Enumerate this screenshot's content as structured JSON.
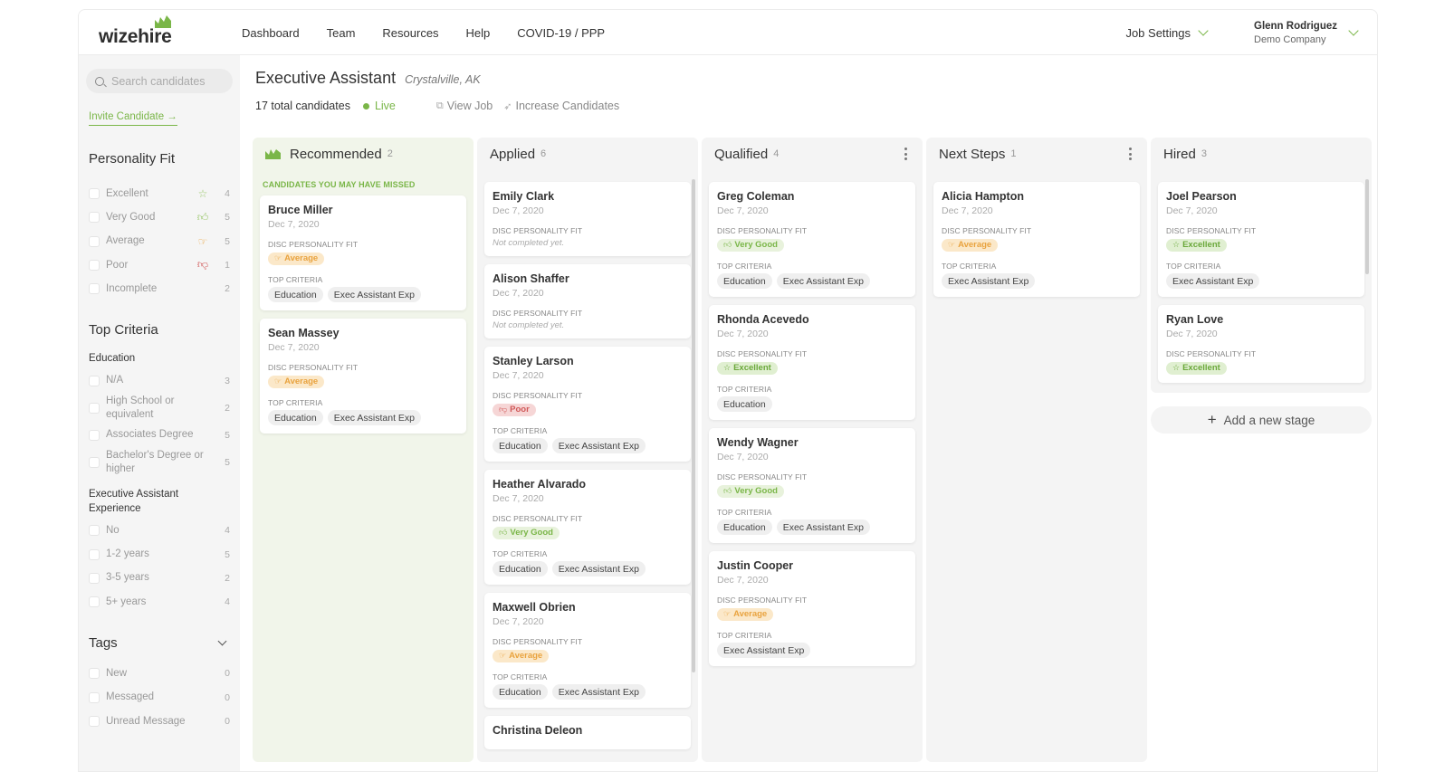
{
  "nav": {
    "logo": "wizehire",
    "links": [
      "Dashboard",
      "Team",
      "Resources",
      "Help",
      "COVID-19 / PPP"
    ],
    "job_settings": "Job Settings",
    "user_name": "Glenn Rodriguez",
    "user_company": "Demo Company"
  },
  "sidebar": {
    "search_placeholder": "Search candidates",
    "invite": "Invite Candidate →",
    "personality_fit": {
      "title": "Personality Fit",
      "items": [
        {
          "label": "Excellent",
          "icon": "star-icon",
          "count": "4"
        },
        {
          "label": "Very Good",
          "icon": "thumbs-up-icon",
          "count": "5"
        },
        {
          "label": "Average",
          "icon": "thumb-sideways-icon",
          "count": "5"
        },
        {
          "label": "Poor",
          "icon": "thumbs-down-icon",
          "count": "1"
        },
        {
          "label": "Incomplete",
          "icon": "",
          "count": "2"
        }
      ]
    },
    "top_criteria": {
      "title": "Top Criteria",
      "education": {
        "title": "Education",
        "items": [
          {
            "label": "N/A",
            "count": "3"
          },
          {
            "label": "High School or equivalent",
            "count": "2"
          },
          {
            "label": "Associates Degree",
            "count": "5"
          },
          {
            "label": "Bachelor's Degree or higher",
            "count": "5"
          }
        ]
      },
      "experience": {
        "title": "Executive Assistant Experience",
        "items": [
          {
            "label": "No",
            "count": "4"
          },
          {
            "label": "1-2 years",
            "count": "5"
          },
          {
            "label": "3-5 years",
            "count": "2"
          },
          {
            "label": "5+ years",
            "count": "4"
          }
        ]
      }
    },
    "tags": {
      "title": "Tags",
      "items": [
        {
          "label": "New",
          "count": "0"
        },
        {
          "label": "Messaged",
          "count": "0"
        },
        {
          "label": "Unread Message",
          "count": "0"
        }
      ]
    }
  },
  "job": {
    "title": "Executive Assistant",
    "location": "Crystalville, AK",
    "total": "17 total candidates",
    "status": "Live",
    "view_job": "View Job",
    "increase": "Increase Candidates"
  },
  "labels": {
    "disc": "DISC PERSONALITY FIT",
    "top_criteria": "TOP CRITERIA",
    "not_completed": "Not completed yet.",
    "missed": "CANDIDATES YOU MAY HAVE MISSED",
    "add_stage": "Add a new stage"
  },
  "colors": {
    "brand_green": "#7ab648",
    "average": "#e9a33f",
    "poor": "#d05858"
  },
  "columns": [
    {
      "name": "Recommended",
      "count": "2",
      "cards": [
        {
          "name": "Bruce Miller",
          "date": "Dec 7, 2020",
          "fit": "Average",
          "criteria": [
            "Education",
            "Exec Assistant Exp"
          ]
        },
        {
          "name": "Sean Massey",
          "date": "Dec 7, 2020",
          "fit": "Average",
          "criteria": [
            "Education",
            "Exec Assistant Exp"
          ]
        }
      ]
    },
    {
      "name": "Applied",
      "count": "6",
      "cards": [
        {
          "name": "Emily Clark",
          "date": "Dec 7, 2020",
          "fit": null,
          "criteria": []
        },
        {
          "name": "Alison Shaffer",
          "date": "Dec 7, 2020",
          "fit": null,
          "criteria": []
        },
        {
          "name": "Stanley Larson",
          "date": "Dec 7, 2020",
          "fit": "Poor",
          "criteria": [
            "Education",
            "Exec Assistant Exp"
          ]
        },
        {
          "name": "Heather Alvarado",
          "date": "Dec 7, 2020",
          "fit": "Very Good",
          "criteria": [
            "Education",
            "Exec Assistant Exp"
          ]
        },
        {
          "name": "Maxwell Obrien",
          "date": "Dec 7, 2020",
          "fit": "Average",
          "criteria": [
            "Education",
            "Exec Assistant Exp"
          ]
        },
        {
          "name": "Christina Deleon",
          "date": "",
          "fit": null,
          "criteria": []
        }
      ]
    },
    {
      "name": "Qualified",
      "count": "4",
      "cards": [
        {
          "name": "Greg Coleman",
          "date": "Dec 7, 2020",
          "fit": "Very Good",
          "criteria": [
            "Education",
            "Exec Assistant Exp"
          ]
        },
        {
          "name": "Rhonda Acevedo",
          "date": "Dec 7, 2020",
          "fit": "Excellent",
          "criteria": [
            "Education"
          ]
        },
        {
          "name": "Wendy Wagner",
          "date": "Dec 7, 2020",
          "fit": "Very Good",
          "criteria": [
            "Education",
            "Exec Assistant Exp"
          ]
        },
        {
          "name": "Justin Cooper",
          "date": "Dec 7, 2020",
          "fit": "Average",
          "criteria": [
            "Exec Assistant Exp"
          ]
        }
      ]
    },
    {
      "name": "Next Steps",
      "count": "1",
      "cards": [
        {
          "name": "Alicia Hampton",
          "date": "Dec 7, 2020",
          "fit": "Average",
          "criteria": [
            "Exec Assistant Exp"
          ]
        }
      ]
    },
    {
      "name": "Hired",
      "count": "3",
      "cards": [
        {
          "name": "Joel Pearson",
          "date": "Dec 7, 2020",
          "fit": "Excellent",
          "criteria": [
            "Exec Assistant Exp"
          ]
        },
        {
          "name": "Ryan Love",
          "date": "Dec 7, 2020",
          "fit": "Excellent",
          "criteria": []
        }
      ]
    }
  ]
}
